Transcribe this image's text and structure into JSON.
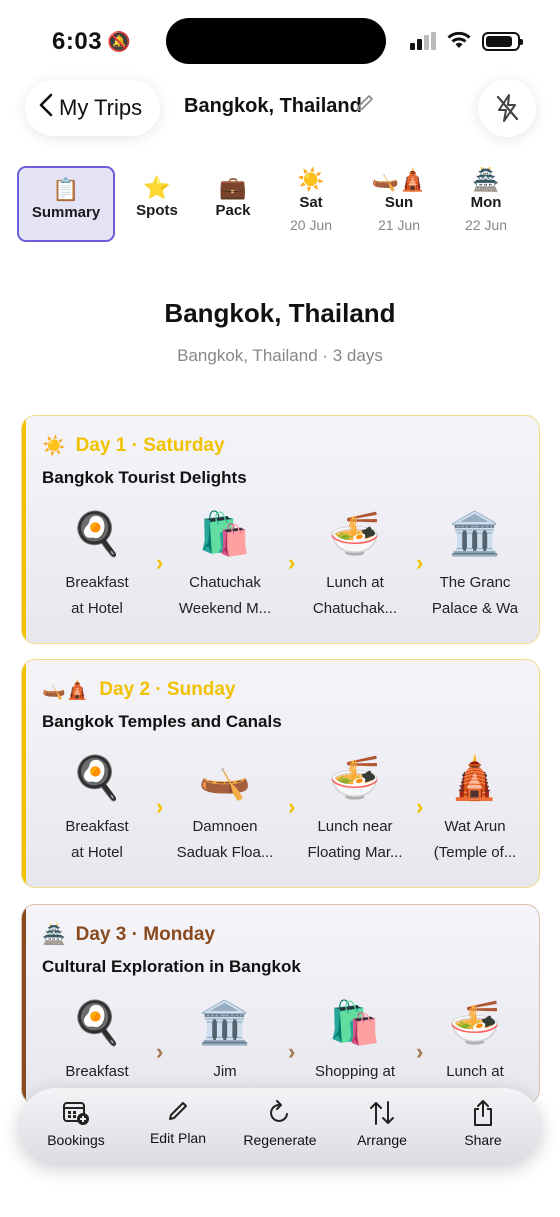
{
  "status": {
    "time": "6:03"
  },
  "header": {
    "back_label": "My Trips",
    "title": "Bangkok, Thailand"
  },
  "tabs": [
    {
      "label": "Summary",
      "icon": "📋",
      "active": true
    },
    {
      "label": "Spots",
      "icon": "⭐"
    },
    {
      "label": "Pack",
      "icon": "💼"
    },
    {
      "label": "Sat",
      "sub": "20 Jun",
      "icon": "☀️"
    },
    {
      "label": "Sun",
      "sub": "21 Jun",
      "icon": "🛶🛕"
    },
    {
      "label": "Mon",
      "sub": "22 Jun",
      "icon": "🏯"
    }
  ],
  "summary": {
    "title": "Bangkok, Thailand",
    "subtitle": "Bangkok, Thailand · 3 days"
  },
  "days": [
    {
      "icon": "☀️",
      "label": "Day 1 · Saturday",
      "theme": "Bangkok Tourist Delights",
      "color": "#f2c200",
      "arrow_color": "#f2c200",
      "stops": [
        {
          "icon": "🍳",
          "name": "Breakfast\nat Hotel"
        },
        {
          "icon": "🛍️",
          "name": "Chatuchak\nWeekend M..."
        },
        {
          "icon": "🍜",
          "name": "Lunch at\nChatuchak..."
        },
        {
          "icon": "🏛️",
          "name": "The Granc\nPalace & Wa"
        }
      ]
    },
    {
      "icon": "🛶🛕",
      "label": "Day 2 · Sunday",
      "theme": "Bangkok Temples and Canals",
      "color": "#f2c200",
      "arrow_color": "#f2c200",
      "stops": [
        {
          "icon": "🍳",
          "name": "Breakfast\nat Hotel"
        },
        {
          "icon": "🛶",
          "name": "Damnoen\nSaduak Floa..."
        },
        {
          "icon": "🍜",
          "name": "Lunch near\nFloating Mar..."
        },
        {
          "icon": "🛕",
          "name": "Wat Arun\n(Temple of..."
        }
      ]
    },
    {
      "icon": "🏯",
      "label": "Day 3 · Monday",
      "theme": "Cultural Exploration in Bangkok",
      "color": "#8a4a1e",
      "arrow_color": "#a5764f",
      "stops": [
        {
          "icon": "🍳",
          "name": "Breakfast"
        },
        {
          "icon": "🏛️",
          "name": "Jim"
        },
        {
          "icon": "🛍️",
          "name": "Shopping at"
        },
        {
          "icon": "🍜",
          "name": "Lunch at"
        }
      ]
    }
  ],
  "toolbar": [
    {
      "label": "Bookings",
      "icon": "calendar-plus-icon"
    },
    {
      "label": "Edit Plan",
      "icon": "pencil-icon"
    },
    {
      "label": "Regenerate",
      "icon": "refresh-icon"
    },
    {
      "label": "Arrange",
      "icon": "arrange-icon"
    },
    {
      "label": "Share",
      "icon": "share-icon"
    }
  ],
  "colors": {
    "accent": "#6a5fd6",
    "active_tab_bg": "#e5e3f6"
  }
}
